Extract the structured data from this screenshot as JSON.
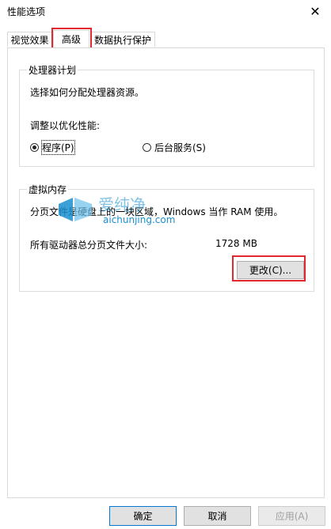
{
  "window": {
    "title": "性能选项"
  },
  "tabs": [
    {
      "label": "视觉效果"
    },
    {
      "label": "高级"
    },
    {
      "label": "数据执行保护"
    }
  ],
  "processor": {
    "legend": "处理器计划",
    "description": "选择如何分配处理器资源。",
    "adjust_label": "调整以优化性能:",
    "option_programs": "程序(P)",
    "option_services": "后台服务(S)",
    "selected": "程序(P)"
  },
  "virtual_memory": {
    "legend": "虚拟内存",
    "description": "分页文件是硬盘上的一块区域，Windows 当作 RAM 使用。",
    "total_label": "所有驱动器总分页文件大小:",
    "total_value": "1728 MB",
    "change_button": "更改(C)..."
  },
  "watermark": {
    "text": "aichunjing.com"
  },
  "footer": {
    "ok": "确定",
    "cancel": "取消",
    "apply": "应用(A)"
  },
  "colors": {
    "highlight_red": "#e0282e",
    "primary_border": "#0078d7"
  }
}
